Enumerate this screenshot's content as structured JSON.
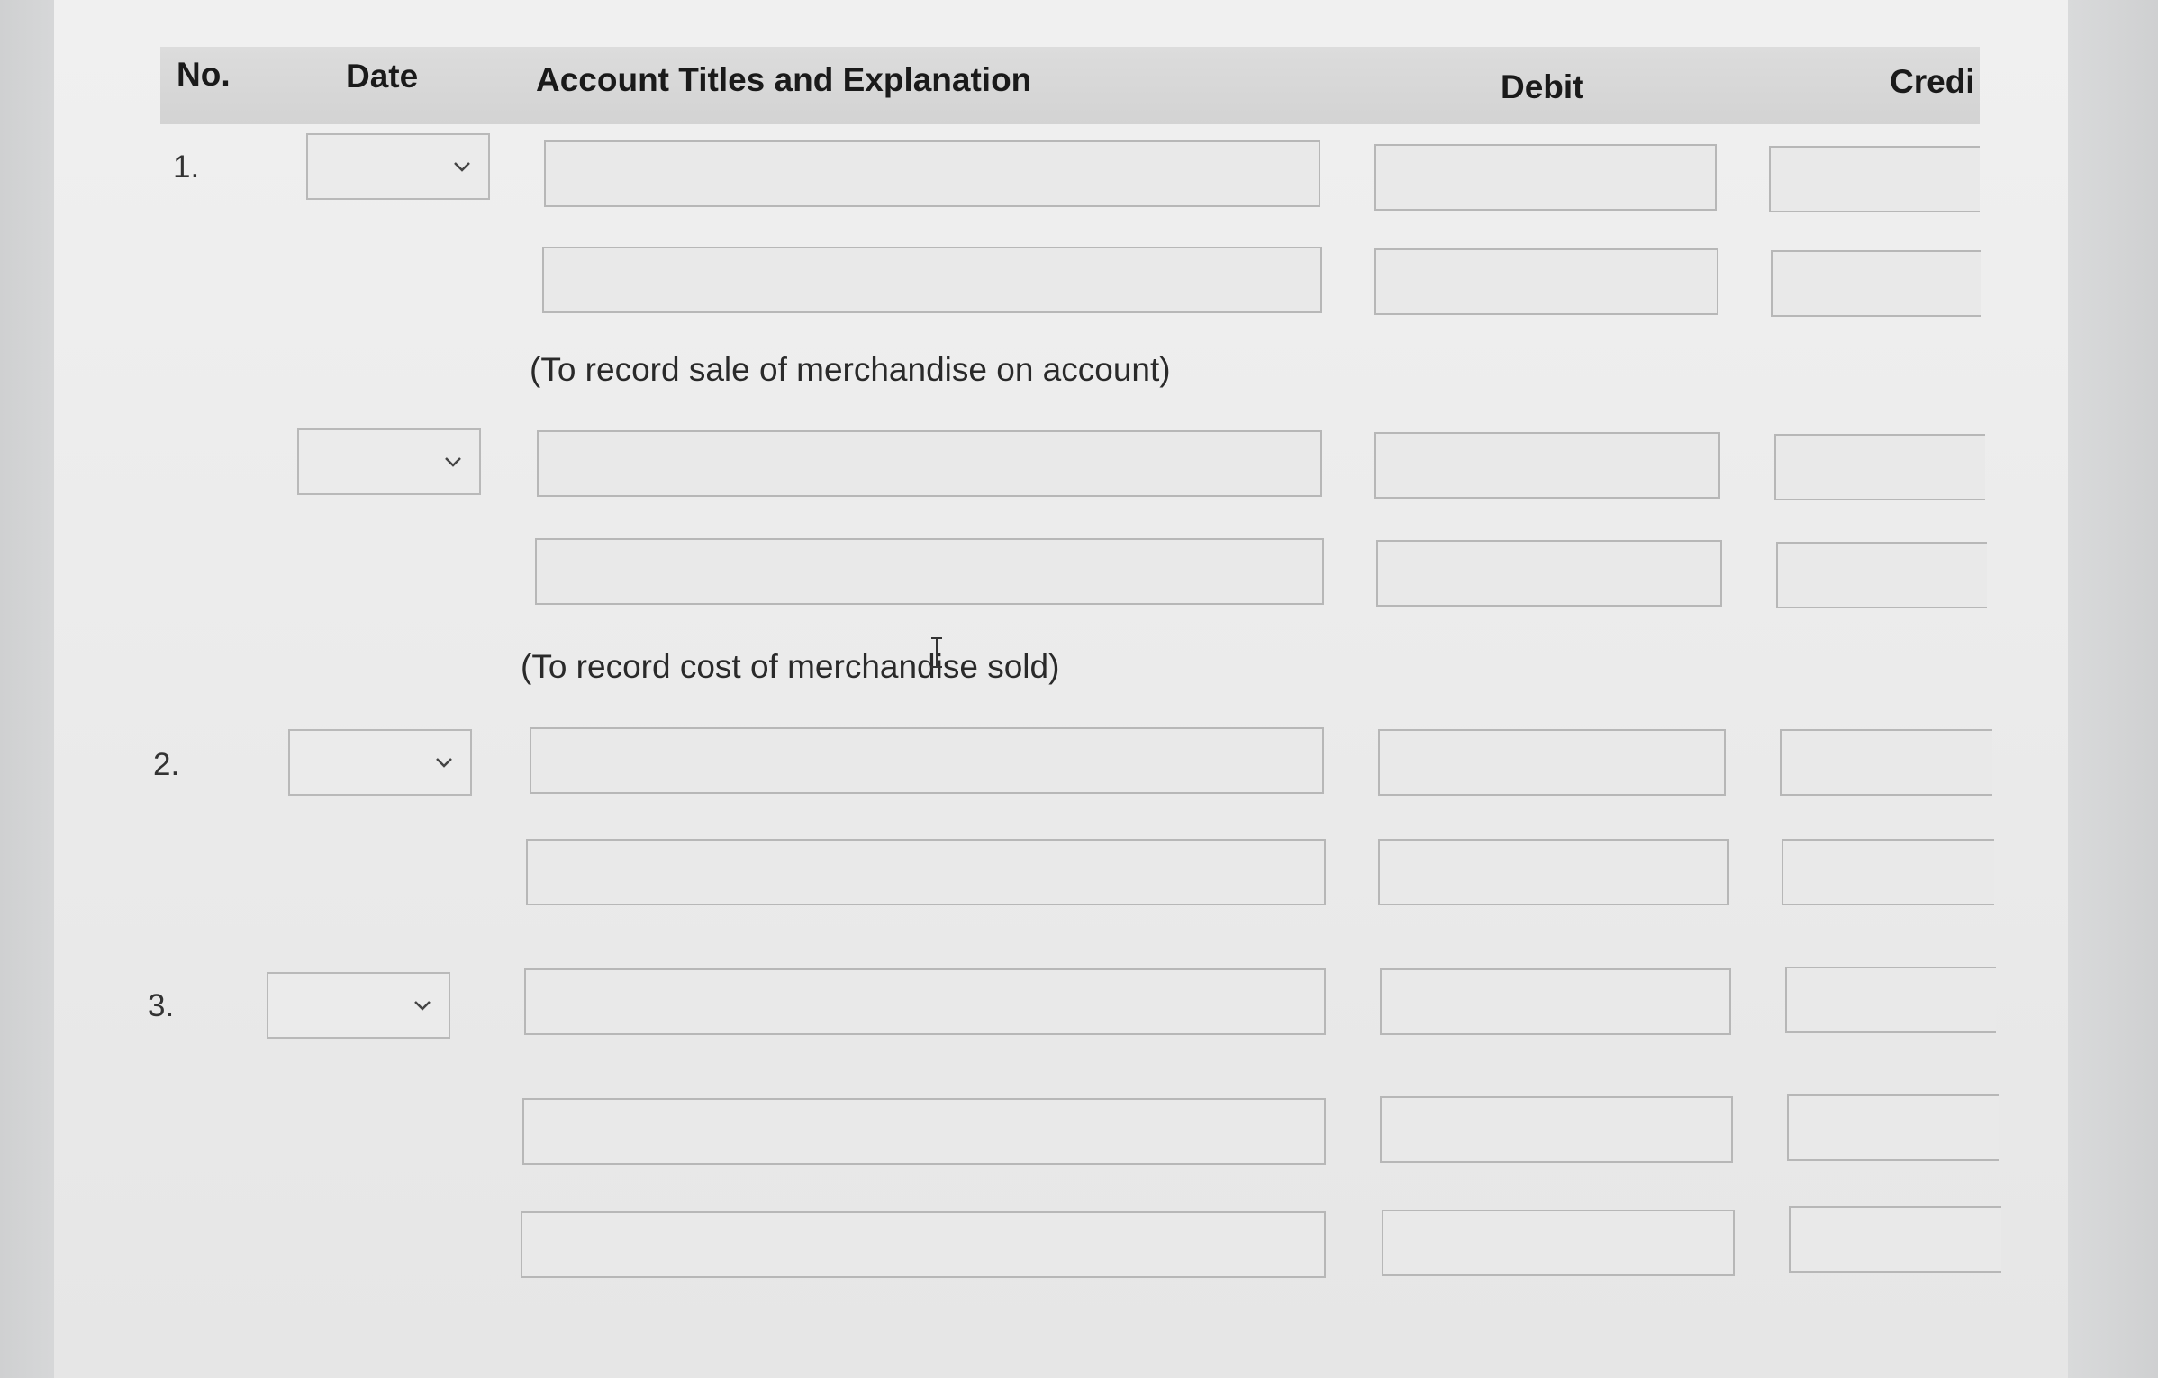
{
  "headers": {
    "no": "No.",
    "date": "Date",
    "account": "Account Titles and Explanation",
    "debit": "Debit",
    "credit": "Credi"
  },
  "entries": [
    {
      "number": "1.",
      "explanation": "(To record sale of merchandise on account)"
    },
    {
      "explanation": "(To record cost of merchandise sold)"
    },
    {
      "number": "2."
    },
    {
      "number": "3."
    }
  ],
  "icons": {
    "date_select": "chevron-down-icon",
    "cursor": "text-cursor-icon"
  },
  "colors": {
    "header_bg": "#d6d6d6",
    "field_bg": "#e9e9e9",
    "field_border": "#b7b7b7"
  }
}
